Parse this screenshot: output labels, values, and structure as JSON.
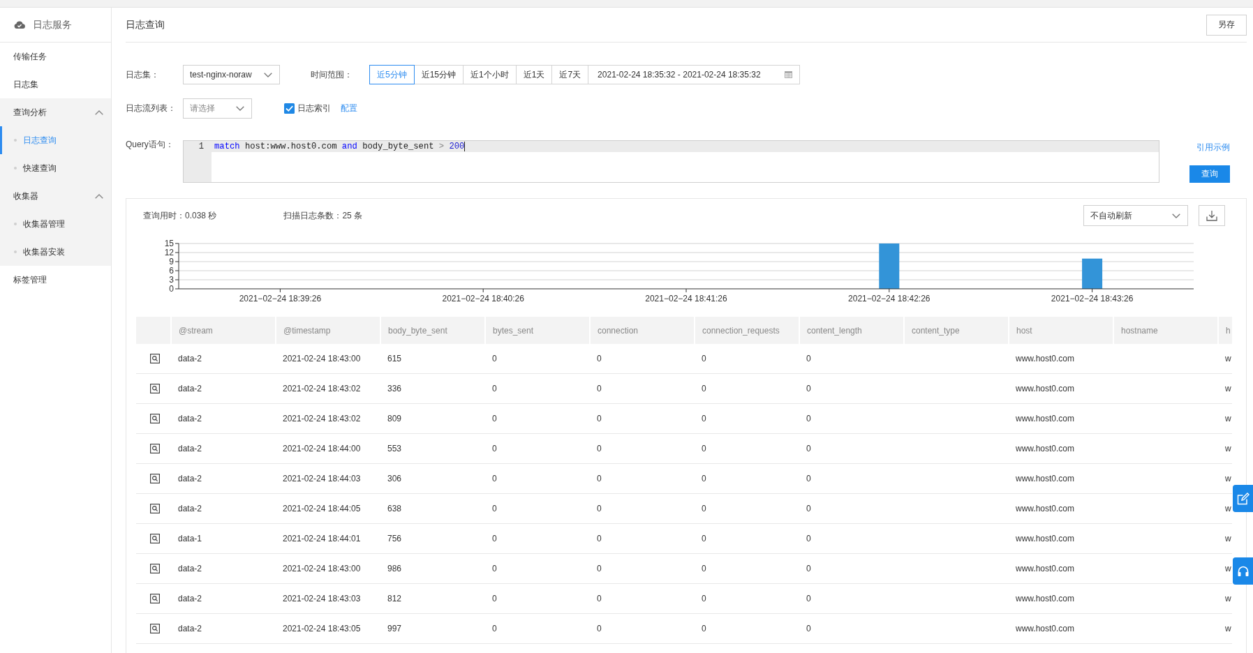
{
  "sidebar": {
    "title": "日志服务",
    "items": [
      {
        "kind": "link",
        "label": "传输任务",
        "selected": false
      },
      {
        "kind": "link",
        "label": "日志集",
        "selected": false
      },
      {
        "kind": "group",
        "label": "查询分析",
        "selected": false,
        "expanded": true,
        "children": [
          {
            "label": "日志查询",
            "selected": true
          },
          {
            "label": "快速查询",
            "selected": false
          }
        ]
      },
      {
        "kind": "group",
        "label": "收集器",
        "selected": false,
        "expanded": true,
        "children": [
          {
            "label": "收集器管理",
            "selected": false
          },
          {
            "label": "收集器安装",
            "selected": false
          }
        ]
      },
      {
        "kind": "link",
        "label": "标签管理",
        "selected": false
      }
    ]
  },
  "page": {
    "title": "日志查询",
    "save_button": "另存"
  },
  "filters": {
    "log_set": {
      "label": "日志集：",
      "value": "test-nginx-noraw"
    },
    "time_range": {
      "label": "时间范围：",
      "options": [
        {
          "label": "近5分钟",
          "selected": true
        },
        {
          "label": "近15分钟",
          "selected": false
        },
        {
          "label": "近1个小时",
          "selected": false
        },
        {
          "label": "近1天",
          "selected": false
        },
        {
          "label": "近7天",
          "selected": false
        }
      ],
      "range": "2021-02-24 18:35:32 - 2021-02-24 18:35:32"
    },
    "log_stream": {
      "label": "日志流列表：",
      "placeholder": "请选择"
    },
    "log_index": {
      "label": "日志索引",
      "checked": true,
      "link": "配置"
    }
  },
  "query": {
    "label": "Query语句：",
    "line_number": "1",
    "tokens": [
      {
        "text": "match",
        "kind": "keyword"
      },
      {
        "text": " host:www.host0.com ",
        "kind": "plain"
      },
      {
        "text": "and",
        "kind": "keyword"
      },
      {
        "text": " body_byte_sent ",
        "kind": "plain"
      },
      {
        "text": ">",
        "kind": "operator"
      },
      {
        "text": " 200",
        "kind": "number"
      }
    ],
    "example_link": "引用示例",
    "submit_button": "查询"
  },
  "results": {
    "query_time": "查询用时：0.038 秒",
    "scanned_count": "扫描日志条数：25 条",
    "refresh": "不自动刷新",
    "chart_data": {
      "type": "bar",
      "categories": [
        "2021−02−24 18:39:26",
        "2021−02−24 18:40:26",
        "2021−02−24 18:41:26",
        "2021−02−24 18:42:26",
        "2021−02−24 18:43:26"
      ],
      "values": [
        0,
        0,
        0,
        15,
        10
      ],
      "ylim": [
        0,
        15
      ],
      "yticks": [
        0,
        3,
        6,
        9,
        12,
        15
      ],
      "grid": true
    },
    "table": {
      "columns": [
        "@stream",
        "@timestamp",
        "body_byte_sent",
        "bytes_sent",
        "connection",
        "connection_requests",
        "content_length",
        "content_type",
        "host",
        "hostname",
        "h"
      ],
      "rows": [
        [
          "data-2",
          "2021-02-24 18:43:00",
          "615",
          "0",
          "0",
          "0",
          "0",
          null,
          "www.host0.com",
          null,
          "w"
        ],
        [
          "data-2",
          "2021-02-24 18:43:02",
          "336",
          "0",
          "0",
          "0",
          "0",
          null,
          "www.host0.com",
          null,
          "w"
        ],
        [
          "data-2",
          "2021-02-24 18:43:02",
          "809",
          "0",
          "0",
          "0",
          "0",
          null,
          "www.host0.com",
          null,
          "w"
        ],
        [
          "data-2",
          "2021-02-24 18:44:00",
          "553",
          "0",
          "0",
          "0",
          "0",
          null,
          "www.host0.com",
          null,
          "w"
        ],
        [
          "data-2",
          "2021-02-24 18:44:03",
          "306",
          "0",
          "0",
          "0",
          "0",
          null,
          "www.host0.com",
          null,
          "w"
        ],
        [
          "data-2",
          "2021-02-24 18:44:05",
          "638",
          "0",
          "0",
          "0",
          "0",
          null,
          "www.host0.com",
          null,
          "w"
        ],
        [
          "data-1",
          "2021-02-24 18:44:01",
          "756",
          "0",
          "0",
          "0",
          "0",
          null,
          "www.host0.com",
          null,
          "w"
        ],
        [
          "data-2",
          "2021-02-24 18:43:00",
          "986",
          "0",
          "0",
          "0",
          "0",
          null,
          "www.host0.com",
          null,
          "w"
        ],
        [
          "data-2",
          "2021-02-24 18:43:03",
          "812",
          "0",
          "0",
          "0",
          "0",
          null,
          "www.host0.com",
          null,
          "w"
        ],
        [
          "data-2",
          "2021-02-24 18:43:05",
          "997",
          "0",
          "0",
          "0",
          "0",
          null,
          "www.host0.com",
          null,
          "w"
        ]
      ]
    }
  }
}
